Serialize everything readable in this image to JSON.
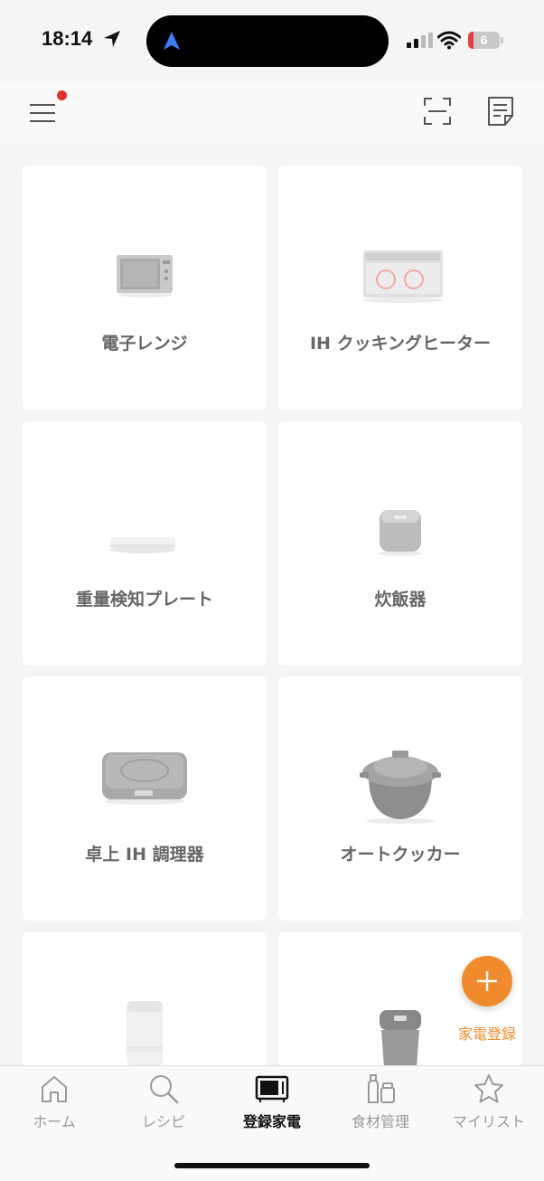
{
  "status_bar": {
    "time": "18:14",
    "battery": "6"
  },
  "header": {
    "menu_icon": "hamburger-menu-icon",
    "scan_icon": "scan-icon",
    "memo_icon": "memo-icon",
    "notification": true
  },
  "appliances": [
    {
      "label": "電子レンジ",
      "icon": "microwave"
    },
    {
      "label": "IH クッキングヒーター",
      "icon": "ih-cooktop"
    },
    {
      "label": "重量検知プレート",
      "icon": "weight-plate"
    },
    {
      "label": "炊飯器",
      "icon": "rice-cooker"
    },
    {
      "label": "卓上 IH 調理器",
      "icon": "tabletop-ih"
    },
    {
      "label": "オートクッカー",
      "icon": "auto-cooker"
    },
    {
      "label": "",
      "icon": "blender"
    },
    {
      "label": "",
      "icon": "trash-bin"
    }
  ],
  "fab": {
    "label": "家電登録"
  },
  "bottom_nav": [
    {
      "label": "ホーム",
      "icon": "home-icon",
      "active": false
    },
    {
      "label": "レシピ",
      "icon": "search-icon",
      "active": false
    },
    {
      "label": "登録家電",
      "icon": "microwave-icon",
      "active": true
    },
    {
      "label": "食材管理",
      "icon": "ingredients-icon",
      "active": false
    },
    {
      "label": "マイリスト",
      "icon": "star-icon",
      "active": false
    }
  ],
  "colors": {
    "accent": "#ef8b2c",
    "notification": "#e0312b",
    "background": "#f5f5f5"
  }
}
